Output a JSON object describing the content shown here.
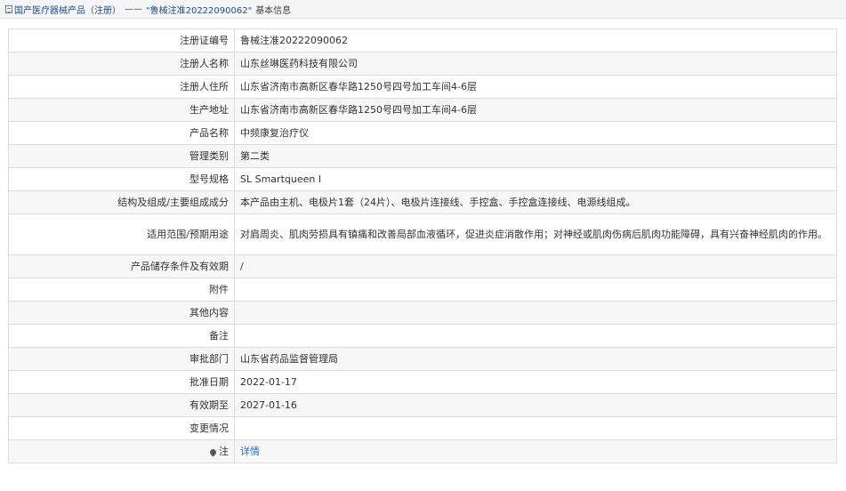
{
  "breadcrumb": {
    "root": "国产医疗器械产品（注册）",
    "separator": "——",
    "current": "\"鲁械注准20222090062\"",
    "suffix": "基本信息"
  },
  "rows": [
    {
      "label": "注册证编号",
      "value": "鲁械注准20222090062"
    },
    {
      "label": "注册人名称",
      "value": "山东丝琳医药科技有限公司"
    },
    {
      "label": "注册人住所",
      "value": "山东省济南市高新区春华路1250号四号加工车间4-6层"
    },
    {
      "label": "生产地址",
      "value": "山东省济南市高新区春华路1250号四号加工车间4-6层"
    },
    {
      "label": "产品名称",
      "value": "中频康复治疗仪"
    },
    {
      "label": "管理类别",
      "value": "第二类"
    },
    {
      "label": "型号规格",
      "value": "SL Smartqueen I"
    },
    {
      "label": "结构及组成/主要组成成分",
      "value": "本产品由主机、电极片1套（24片）、电极片连接线、手控盒、手控盒连接线、电源线组成。"
    },
    {
      "label": "适用范围/预期用途",
      "value": "对肩周炎、肌肉劳损具有镇痛和改善局部血液循环，促进炎症消散作用；对神经或肌肉伤病后肌肉功能障碍，具有兴奋神经肌肉的作用。"
    },
    {
      "label": "产品储存条件及有效期",
      "value": "/"
    },
    {
      "label": "附件",
      "value": ""
    },
    {
      "label": "其他内容",
      "value": ""
    },
    {
      "label": "备注",
      "value": ""
    },
    {
      "label": "审批部门",
      "value": "山东省药品监督管理局"
    },
    {
      "label": "批准日期",
      "value": "2022-01-17"
    },
    {
      "label": "有效期至",
      "value": "2027-01-16"
    },
    {
      "label": "变更情况",
      "value": ""
    }
  ],
  "note": {
    "label": "注",
    "link": "详情"
  }
}
